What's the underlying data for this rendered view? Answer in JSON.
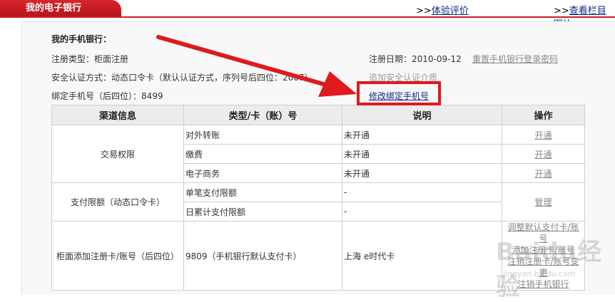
{
  "header": {
    "tab_title": "我的电子银行",
    "link_feedback_arrow": ">>",
    "link_feedback": "体验评价",
    "link_columns_arrow": ">>",
    "link_columns": "查看栏目图片"
  },
  "info": {
    "title": "我的手机银行：",
    "reg_type": "注册类型：柜面注册",
    "security_auth": "安全认证方式：动态口令卡（默认认证方式，序列号后四位：2007）",
    "bound_phone": "绑定手机号（后四位）：8499",
    "reg_date": "注册日期：2010-09-12",
    "reset_password": "重置手机银行登录密码",
    "add_security": "追加安全认证介质",
    "modify_phone": "修改绑定手机号"
  },
  "table": {
    "headers": [
      "渠道信息",
      "类型/卡（账）号",
      "说明",
      "操作"
    ],
    "groups": {
      "trade": {
        "channel": "交易权限",
        "rows": [
          {
            "type": "对外转账",
            "desc": "未开通",
            "op": "开通"
          },
          {
            "type": "缴费",
            "desc": "未开通",
            "op": "开通"
          },
          {
            "type": "电子商务",
            "desc": "未开通",
            "op": "开通"
          }
        ]
      },
      "limit": {
        "channel": "支付限额（动态口令卡）",
        "rows": [
          {
            "type": "单笔支付限额",
            "desc": "-"
          },
          {
            "type": "日累计支付限额",
            "desc": "-"
          }
        ],
        "op": "管理"
      },
      "card": {
        "channel": "柜面添加注册卡/账号（后四位）",
        "type": "9809（手机银行默认支付卡）",
        "desc": "上海 e时代卡",
        "ops": [
          "调整默认支付卡/账号",
          "添加注册卡/账号",
          "注销注册卡/账号变更",
          "注销手机银行"
        ]
      }
    }
  },
  "watermark": {
    "text": "Baidu经验",
    "sub": "jingyan.baidu.com"
  },
  "colors": {
    "brand_red": "#c81e24",
    "link_blue": "#0b2a8a",
    "annotation_red": "#e0191e"
  }
}
